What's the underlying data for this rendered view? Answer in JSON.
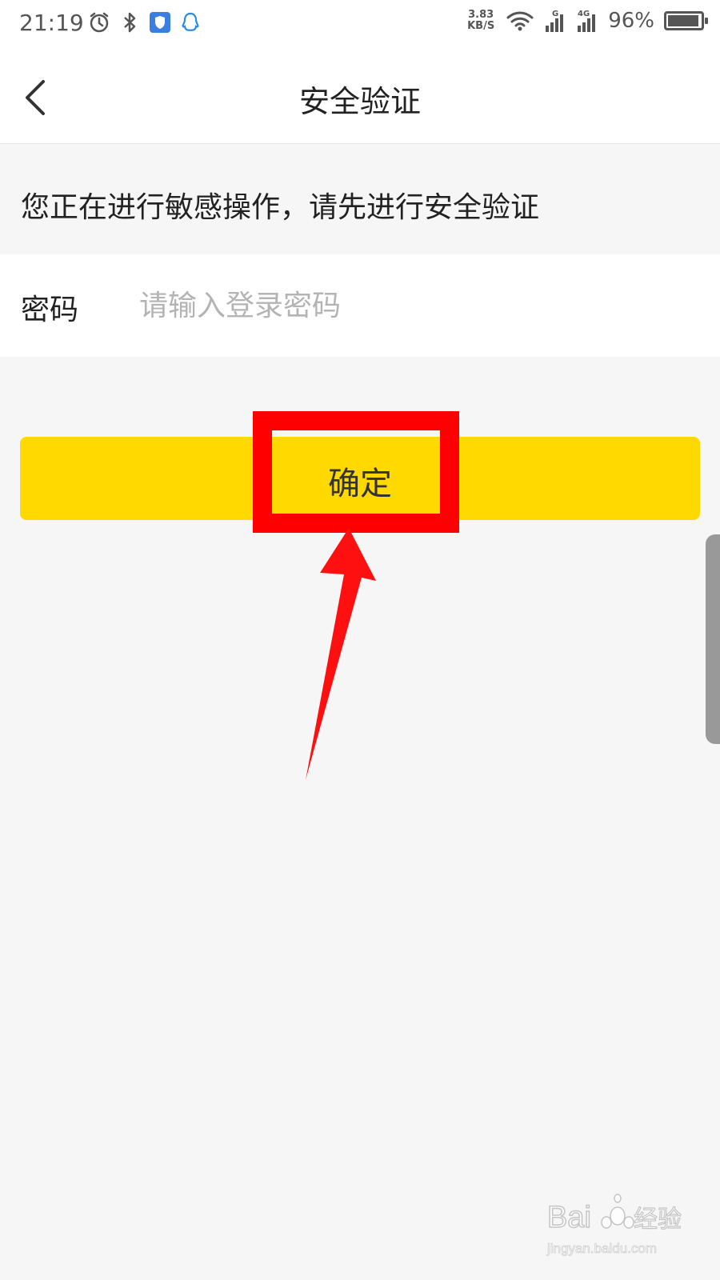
{
  "status_bar": {
    "time": "21:19",
    "net_speed_value": "3.83",
    "net_speed_unit": "KB/S",
    "battery_percent": "96%",
    "battery_level": 0.96,
    "icons_left": [
      "alarm-icon",
      "bluetooth-icon",
      "shield-app-icon",
      "qq-icon"
    ],
    "icons_right": [
      "wifi-icon",
      "signal-g-icon",
      "signal-4g-icon",
      "battery-icon"
    ]
  },
  "nav": {
    "back_icon": "chevron-left-icon",
    "title": "安全验证"
  },
  "notice": {
    "text": "您正在进行敏感操作，请先进行安全验证"
  },
  "password": {
    "label": "密码",
    "placeholder": "请输入登录密码",
    "value": ""
  },
  "confirm": {
    "label": "确定"
  },
  "colors": {
    "accent": "#ffd900",
    "annotation": "#ff0000",
    "background": "#f6f6f6"
  },
  "watermark": {
    "brand": "Bai 经验",
    "url": "jingyan.baidu.com"
  }
}
